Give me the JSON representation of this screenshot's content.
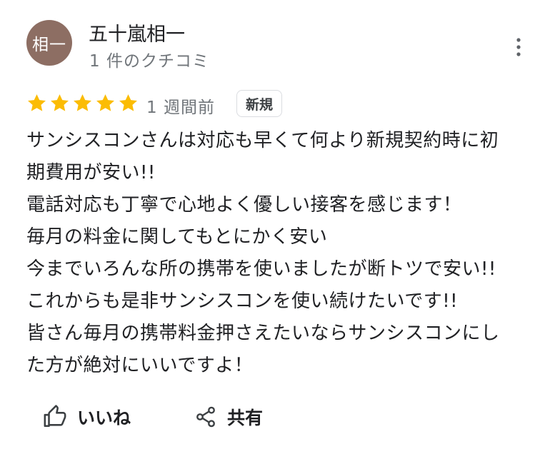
{
  "reviewer": {
    "avatar_text": "相一",
    "avatar_color": "#8d6e63",
    "name": "五十嵐相一",
    "meta": "1 件のクチコミ"
  },
  "review": {
    "rating": 5,
    "star_color": "#fbbc04",
    "time_ago": "1 週間前",
    "badge": "新規",
    "text": "サンシスコンさんは対応も早くて何より新規契約時に初\n期費用が安い!!\n電話対応も丁寧で心地よく優しい接客を感じます！\n毎月の料金に関してもとにかく安い\n今までいろんな所の携帯を使いましたが断トツで安い!!\nこれからも是非サンシスコンを使い続けたいです!!\n皆さん毎月の携帯料金押さえたいならサンシスコンにし\nた方が絶対にいいですよ！"
  },
  "actions": {
    "like_label": "いいね",
    "share_label": "共有"
  },
  "icons": {
    "more": "more-vert-icon",
    "like": "thumb-up-icon",
    "share": "share-icon",
    "star": "star-icon"
  }
}
